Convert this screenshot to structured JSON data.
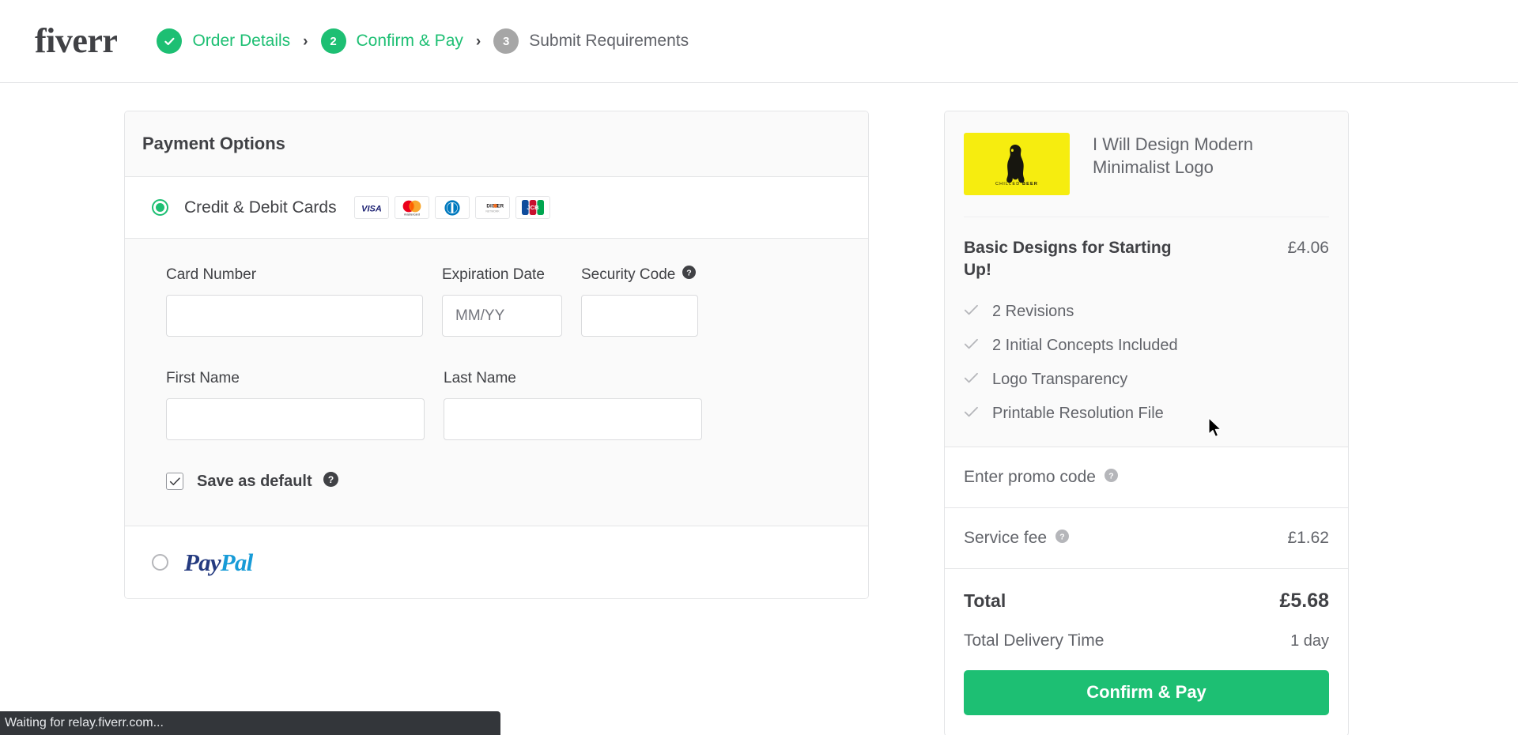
{
  "header": {
    "brand": "fiverr",
    "steps": [
      {
        "badge": "check",
        "label": "Order Details",
        "state": "done"
      },
      {
        "badge": "2",
        "label": "Confirm & Pay",
        "state": "active"
      },
      {
        "badge": "3",
        "label": "Submit Requirements",
        "state": "todo"
      }
    ],
    "separator": "›"
  },
  "payment": {
    "title": "Payment Options",
    "credit_label": "Credit & Debit Cards",
    "card_brands": [
      "visa-logo",
      "mastercard-logo",
      "diners-club-logo",
      "discover-logo",
      "jcb-logo"
    ],
    "fields": {
      "card_number_label": "Card Number",
      "card_number_value": "",
      "card_number_placeholder": "",
      "expiration_label": "Expiration Date",
      "expiration_value": "",
      "expiration_placeholder": "MM/YY",
      "security_label": "Security Code",
      "security_value": "",
      "security_placeholder": "",
      "first_name_label": "First Name",
      "first_name_value": "",
      "first_name_placeholder": "",
      "last_name_label": "Last Name",
      "last_name_value": "",
      "last_name_placeholder": ""
    },
    "save_default_label": "Save as default",
    "save_default_checked": true,
    "paypal_primary": "Pay",
    "paypal_secondary": "Pal"
  },
  "summary": {
    "gig_title": "I Will Design Modern Minimalist Logo",
    "thumb_caption_light": "CHILLED ",
    "thumb_caption_bold": "BEER",
    "package_name": "Basic Designs for Starting Up!",
    "package_price": "£4.06",
    "features": [
      "2 Revisions",
      "2 Initial Concepts Included",
      "Logo Transparency",
      "Printable Resolution File"
    ],
    "promo_label": "Enter promo code",
    "service_fee_label": "Service fee",
    "service_fee_value": "£1.62",
    "total_label": "Total",
    "total_value": "£5.68",
    "delivery_label": "Total Delivery Time",
    "delivery_value": "1 day",
    "cta_label": "Confirm & Pay"
  },
  "statusbar": {
    "text": "Waiting for relay.fiverr.com..."
  },
  "colors": {
    "brand_green": "#1dbf73",
    "text_dark": "#404145",
    "text_gray": "#62646a",
    "border": "#e4e5e7",
    "thumb_yellow": "#f6ed0f"
  }
}
